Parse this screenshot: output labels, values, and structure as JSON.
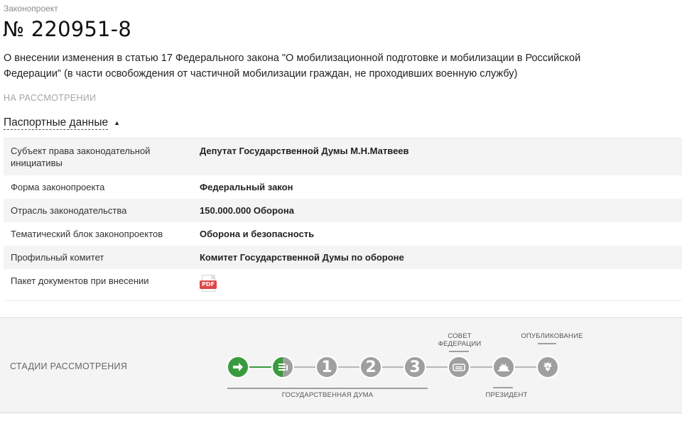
{
  "header": {
    "doc_type": "Законопроект",
    "number": "№ 220951-8",
    "title": "О внесении изменения в статью 17 Федерального закона \"О мобилизационной подготовке и мобилизации в Российской Федерации\" (в части освобождения от частичной мобилизации граждан, не проходивших военную службу)",
    "status": "НА РАССМОТРЕНИИ"
  },
  "passport": {
    "toggle_label": "Паспортные данные",
    "rows": [
      {
        "key": "Субъект права законодательной инициативы",
        "value": "Депутат Государственной Думы М.Н.Матвеев"
      },
      {
        "key": "Форма законопроекта",
        "value": "Федеральный закон"
      },
      {
        "key": "Отрасль законодательства",
        "value": "150.000.000 Оборона"
      },
      {
        "key": "Тематический блок законопроектов",
        "value": "Оборона и безопасность"
      },
      {
        "key": "Профильный комитет",
        "value": "Комитет Государственной Думы по обороне"
      },
      {
        "key": "Пакет документов при внесении",
        "value": "",
        "attachment": {
          "type": "pdf",
          "label": "PDF",
          "icon": "pdf-file-icon"
        }
      }
    ]
  },
  "stages": {
    "title": "СТАДИИ РАССМОТРЕНИЯ",
    "nodes": [
      {
        "icon": "arrow-right-icon",
        "state": "done"
      },
      {
        "icon": "document-list-icon",
        "state": "in-progress"
      },
      {
        "label": "1",
        "state": "pending"
      },
      {
        "label": "2",
        "state": "pending"
      },
      {
        "label": "3",
        "state": "pending"
      },
      {
        "icon": "federation-council-icon",
        "state": "pending"
      },
      {
        "icon": "president-icon",
        "state": "pending"
      },
      {
        "icon": "emblem-icon",
        "state": "pending"
      }
    ],
    "groups": {
      "duma": "ГОСУДАРСТВЕННАЯ ДУМА",
      "federation_council": "СОВЕТ ФЕДЕРАЦИИ",
      "president": "ПРЕЗИДЕНТ",
      "publication": "ОПУБЛИКОВАНИЕ"
    }
  },
  "colors": {
    "accent_green": "#3a9b3e",
    "pending_grey": "#9f9f9f",
    "pdf_red": "#e04646"
  }
}
